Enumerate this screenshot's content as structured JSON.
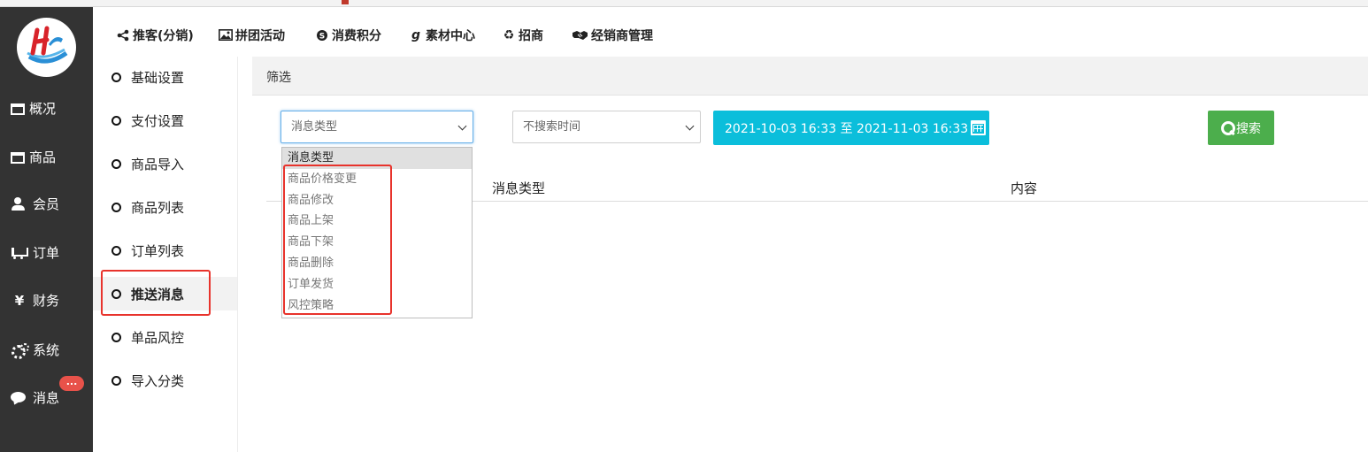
{
  "sidebar": {
    "items": [
      {
        "label": "概况",
        "icon": "window-icon"
      },
      {
        "label": "商品",
        "icon": "window-icon"
      },
      {
        "label": "会员",
        "icon": "users-icon"
      },
      {
        "label": "订单",
        "icon": "cart-icon"
      },
      {
        "label": "财务",
        "icon": "yen-icon"
      },
      {
        "label": "系统",
        "icon": "gears-icon"
      },
      {
        "label": "消息",
        "icon": "chat-icon"
      }
    ],
    "badge": "..."
  },
  "topnav": {
    "items": [
      {
        "label": "推客(分销)",
        "icon": "share-icon"
      },
      {
        "label": "拼团活动",
        "icon": "image-icon"
      },
      {
        "label": "消费积分",
        "icon": "skype-icon"
      },
      {
        "label": "素材中心",
        "icon": "git-icon"
      },
      {
        "label": "招商",
        "icon": "recycle-icon"
      },
      {
        "label": "经销商管理",
        "icon": "handshake-icon"
      }
    ]
  },
  "submenu": {
    "items": [
      {
        "label": "基础设置"
      },
      {
        "label": "支付设置"
      },
      {
        "label": "商品导入"
      },
      {
        "label": "商品列表"
      },
      {
        "label": "订单列表"
      },
      {
        "label": "推送消息",
        "active": true
      },
      {
        "label": "单品风控"
      },
      {
        "label": "导入分类"
      }
    ]
  },
  "main": {
    "filter_title": "筛选",
    "type_select": {
      "value": "消息类型"
    },
    "time_select": {
      "value": "不搜索时间"
    },
    "date_range": "2021-10-03 16:33 至 2021-11-03 16:33",
    "search_label": "搜索",
    "table": {
      "headers": [
        "消息类型",
        "内容"
      ]
    },
    "dropdown": {
      "options": [
        "消息类型",
        "商品价格变更",
        "商品修改",
        "商品上架",
        "商品下架",
        "商品删除",
        "订单发货",
        "风控策略"
      ],
      "selected_index": 0
    }
  },
  "colors": {
    "sidebar_bg": "#333333",
    "date_button": "#0bbedb",
    "search_button": "#4cae4c",
    "highlight_box": "#e8332c",
    "badge": "#e8524a"
  }
}
